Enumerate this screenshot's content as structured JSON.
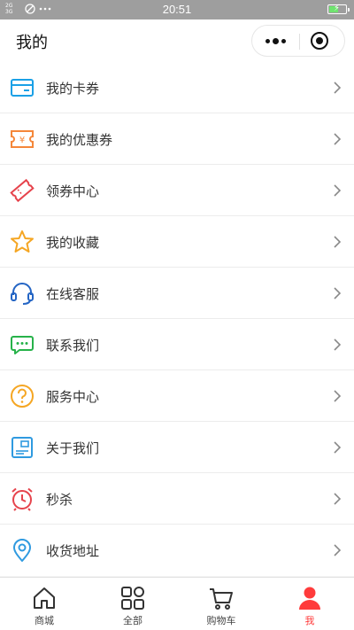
{
  "status": {
    "time": "20:51",
    "signal_text": "2G 3G",
    "battery_level": 0.55
  },
  "header": {
    "title": "我的"
  },
  "menu": {
    "items": [
      {
        "label": "我的卡券",
        "icon": "card-icon",
        "color": "#1aa0e6"
      },
      {
        "label": "我的优惠券",
        "icon": "coupon-icon",
        "color": "#f5873a"
      },
      {
        "label": "领券中心",
        "icon": "ticket-icon",
        "color": "#e6434c"
      },
      {
        "label": "我的收藏",
        "icon": "star-icon",
        "color": "#f5a623"
      },
      {
        "label": "在线客服",
        "icon": "headset-icon",
        "color": "#2465c4"
      },
      {
        "label": "联系我们",
        "icon": "chat-icon",
        "color": "#27b24a"
      },
      {
        "label": "服务中心",
        "icon": "question-icon",
        "color": "#f5a623"
      },
      {
        "label": "关于我们",
        "icon": "info-card-icon",
        "color": "#2f9ae0"
      },
      {
        "label": "秒杀",
        "icon": "alarm-clock-icon",
        "color": "#e6434c"
      },
      {
        "label": "收货地址",
        "icon": "location-pin-icon",
        "color": "#2f9ae0"
      }
    ]
  },
  "tabbar": {
    "tabs": [
      {
        "label": "商城",
        "icon": "home-icon"
      },
      {
        "label": "全部",
        "icon": "grid-icon"
      },
      {
        "label": "购物车",
        "icon": "cart-icon"
      },
      {
        "label": "我",
        "icon": "user-icon"
      }
    ],
    "active_index": 3,
    "active_color": "#ff3b3b"
  }
}
